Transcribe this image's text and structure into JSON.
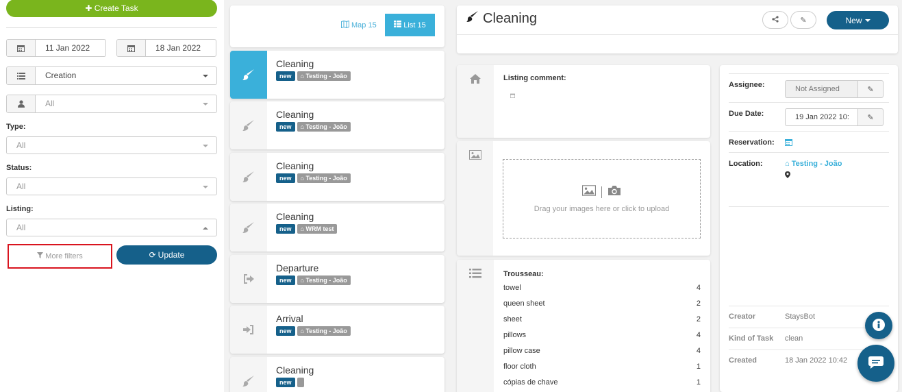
{
  "filters": {
    "create_task_label": "Create Task",
    "date_from": "11 Jan 2022",
    "date_to": "18 Jan 2022",
    "sort_by": "Creation",
    "user": "All",
    "type_label": "Type:",
    "type_value": "All",
    "status_label": "Status:",
    "status_value": "All",
    "listing_label": "Listing:",
    "listing_value": "All",
    "more_filters_label": "More filters",
    "update_label": "Update"
  },
  "view_toggle": {
    "map_label": "Map 15",
    "list_label": "List 15"
  },
  "tasks": [
    {
      "title": "Cleaning",
      "status": "new",
      "listing": "Testing - João",
      "icon": "brush-icon",
      "active": true
    },
    {
      "title": "Cleaning",
      "status": "new",
      "listing": "Testing - João",
      "icon": "brush-icon",
      "active": false
    },
    {
      "title": "Cleaning",
      "status": "new",
      "listing": "Testing - João",
      "icon": "brush-icon",
      "active": false
    },
    {
      "title": "Cleaning",
      "status": "new",
      "listing": "WRM test",
      "icon": "brush-icon",
      "active": false
    },
    {
      "title": "Departure",
      "status": "new",
      "listing": "Testing - João",
      "icon": "sign-out-icon",
      "active": false
    },
    {
      "title": "Arrival",
      "status": "new",
      "listing": "Testing - João",
      "icon": "sign-in-icon",
      "active": false
    },
    {
      "title": "Cleaning",
      "status": "new",
      "listing": "",
      "icon": "brush-icon",
      "active": false
    }
  ],
  "detail": {
    "title": "Cleaning",
    "new_button_label": "New",
    "listing_comment_label": "Listing comment:",
    "upload_text": "Drag your images here or click to upload",
    "trousseau_label": "Trousseau:",
    "trousseau": [
      {
        "item": "towel",
        "qty": "4"
      },
      {
        "item": "queen sheet",
        "qty": "2"
      },
      {
        "item": "sheet",
        "qty": "2"
      },
      {
        "item": "pillows",
        "qty": "4"
      },
      {
        "item": "pillow case",
        "qty": "4"
      },
      {
        "item": "floor cloth",
        "qty": "1"
      },
      {
        "item": "cópias de chave",
        "qty": "1"
      }
    ]
  },
  "info": {
    "assignee_label": "Assignee:",
    "assignee_value": "Not Assigned",
    "due_date_label": "Due Date:",
    "due_date_value": "19 Jan 2022 10:",
    "reservation_label": "Reservation:",
    "location_label": "Location:",
    "location_value": "Testing - João",
    "creator_label": "Creator",
    "creator_value": "StaysBot",
    "kind_label": "Kind of Task",
    "kind_value": "clean",
    "created_label": "Created",
    "created_value": "18 Jan 2022 10:42"
  },
  "colors": {
    "primary": "#15608a",
    "accent": "#3ab0da",
    "success": "#7ab51d",
    "highlight": "#d9141e"
  }
}
